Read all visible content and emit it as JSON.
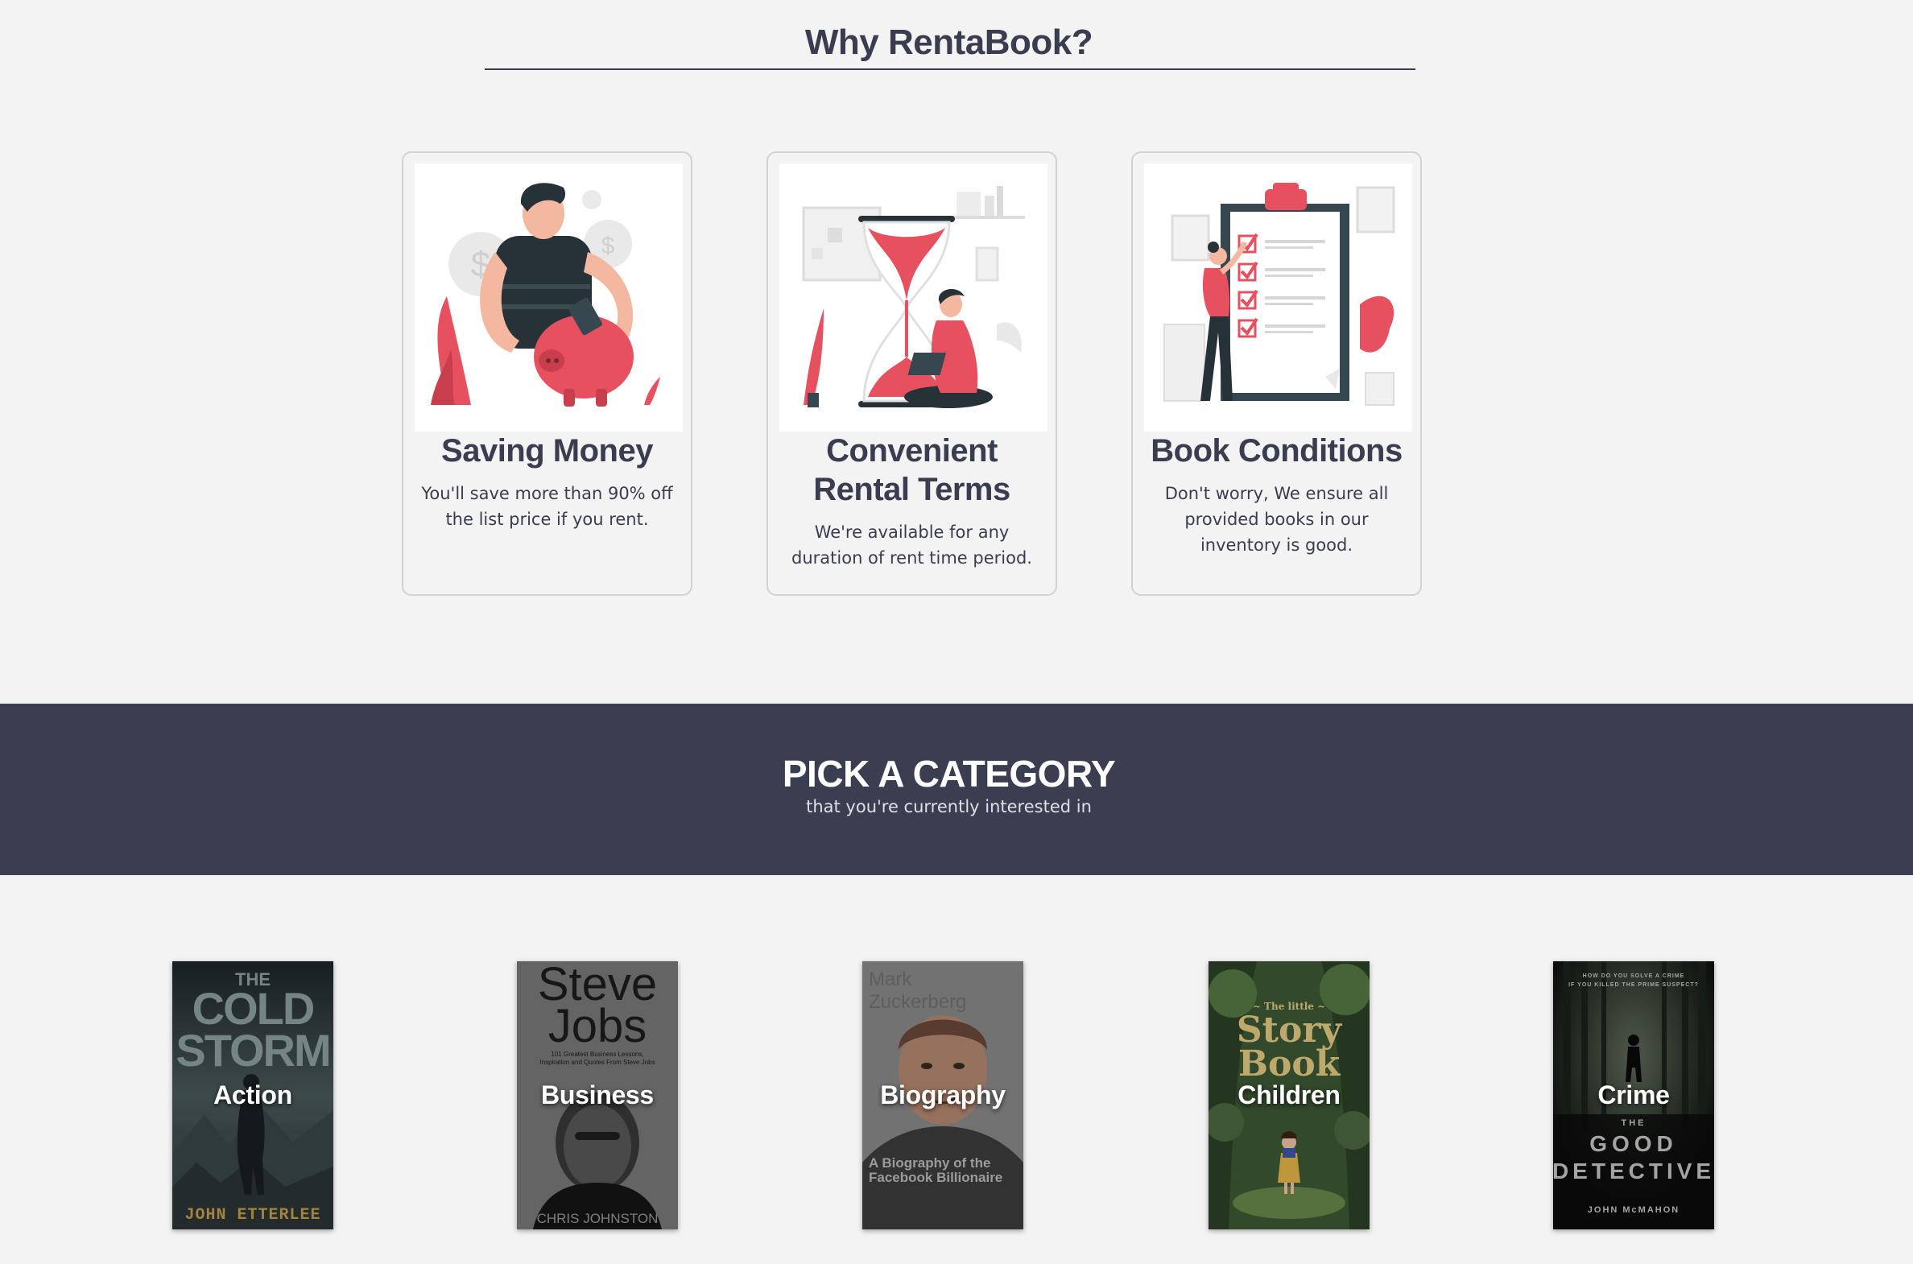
{
  "why": {
    "title": "Why RentaBook?",
    "cards": [
      {
        "title": "Saving Money",
        "desc": "You'll save more than 90% off the list price if you rent.",
        "icon": "piggy-bank-illustration"
      },
      {
        "title": "Convenient Rental Terms",
        "desc": "We're available for any duration of rent time period.",
        "icon": "hourglass-illustration"
      },
      {
        "title": "Book Conditions",
        "desc": "Don't worry, We ensure all provided books in our inventory is good.",
        "icon": "checklist-illustration"
      }
    ]
  },
  "categories": {
    "title": "PICK A CATEGORY",
    "subtitle": "that you're currently interested in",
    "items": [
      {
        "label": "Action",
        "cover_title": "THE COLD STORM",
        "cover_author": "JOHN ETTERLEE"
      },
      {
        "label": "Business",
        "cover_title": "Steve Jobs",
        "cover_subtitle": "101 Greatest Business Lessons, Inspiration and Quotes From Steve Jobs",
        "cover_author": "CHRIS JOHNSTON"
      },
      {
        "label": "Biography",
        "cover_title": "Mark Zuckerberg",
        "cover_subtitle": "A Biography of the Facebook Billionaire"
      },
      {
        "label": "Children",
        "cover_title": "The little Story Book"
      },
      {
        "label": "Crime",
        "cover_title": "THE GOOD DETECTIVE",
        "cover_tagline": "HOW DO YOU SOLVE A CRIME IF YOU KILLED THE PRIME SUSPECT?",
        "cover_author": "JOHN McMAHON"
      }
    ]
  },
  "colors": {
    "accent": "#e6505f",
    "dark": "#3b3e50",
    "background": "#f3f3f3"
  }
}
